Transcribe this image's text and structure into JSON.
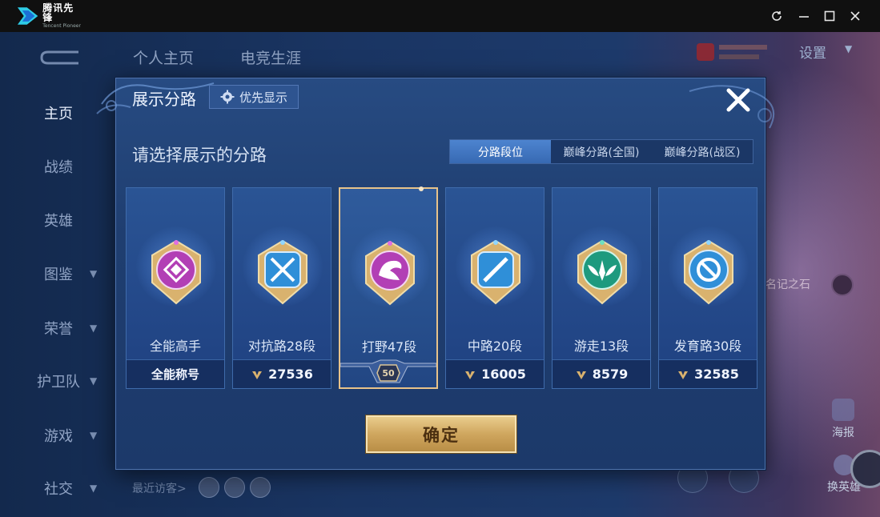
{
  "app": {
    "name": "腾讯先锋",
    "name_en": "Tencent Pioneer",
    "window_controls": [
      "refresh-icon",
      "minimize-icon",
      "maximize-icon",
      "close-icon"
    ]
  },
  "background": {
    "top_tabs": [
      "个人主页",
      "电竞生涯"
    ],
    "nav": [
      {
        "label": "主页",
        "has_chevron": false,
        "active": true
      },
      {
        "label": "战绩",
        "has_chevron": false
      },
      {
        "label": "英雄",
        "has_chevron": false
      },
      {
        "label": "图鉴",
        "has_chevron": true
      },
      {
        "label": "荣誉",
        "has_chevron": true
      },
      {
        "label": "护卫队",
        "has_chevron": true
      },
      {
        "label": "游戏",
        "has_chevron": true
      },
      {
        "label": "社交",
        "has_chevron": true
      }
    ],
    "settings_label": "设置",
    "right_text": "名记之石",
    "poster_label": "海报",
    "swap_hero_label": "换英雄",
    "recent_visitors_label": "最近访客>"
  },
  "modal": {
    "title": "展示分路",
    "priority_button": "优先显示",
    "subtitle": "请选择展示的分路",
    "tabs": [
      {
        "label": "分路段位",
        "active": true
      },
      {
        "label": "巅峰分路(全国)",
        "active": false
      },
      {
        "label": "巅峰分路(战区)",
        "active": false
      }
    ],
    "cards": [
      {
        "name": "全能高手",
        "footer_text": "全能称号",
        "points": null,
        "color": "#b23fb5",
        "selected": false
      },
      {
        "name": "对抗路28段",
        "points": "27536",
        "color": "#2f8fd8",
        "selected": false
      },
      {
        "name": "打野47段",
        "points": null,
        "level": "50",
        "color": "#b23fb5",
        "selected": true
      },
      {
        "name": "中路20段",
        "points": "16005",
        "color": "#2f8fd8",
        "selected": false
      },
      {
        "name": "游走13段",
        "points": "8579",
        "color": "#1e9a7e",
        "selected": false
      },
      {
        "name": "发育路30段",
        "points": "32585",
        "color": "#2f8fd8",
        "selected": false
      }
    ],
    "confirm_button": "确定"
  },
  "colors": {
    "modal_bg": "#244680",
    "gold": "#d9b26e",
    "active_tab": "#3f75c2"
  }
}
